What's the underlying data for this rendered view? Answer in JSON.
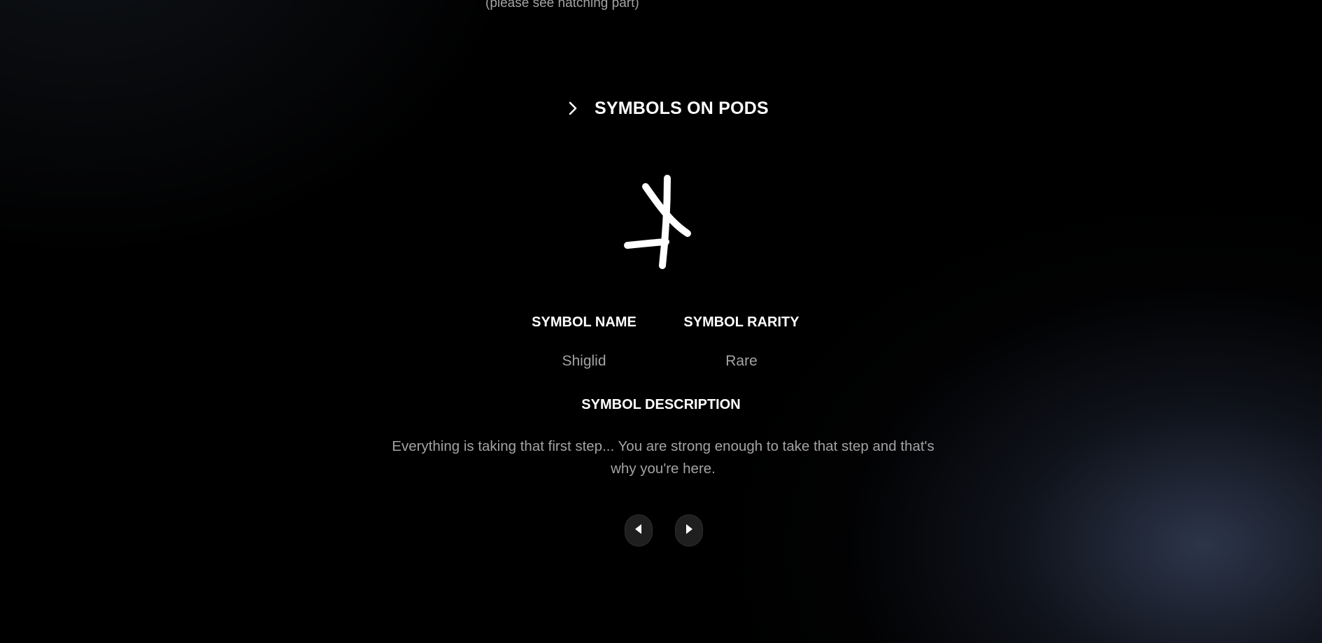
{
  "top_note": "(please see hatching part)",
  "section": {
    "title": "SYMBOLS ON PODS",
    "toggle_icon": "chevron-right-icon"
  },
  "symbol": {
    "glyph_icon": "shiglid-symbol-icon",
    "name_label": "SYMBOL NAME",
    "name_value": "Shiglid",
    "rarity_label": "SYMBOL RARITY",
    "rarity_value": "Rare",
    "description_label": "SYMBOL DESCRIPTION",
    "description": "Everything is taking that first step... You are strong enough to take that step and that's why you're here."
  },
  "navigation": {
    "prev_icon": "triangle-left-icon",
    "next_icon": "triangle-right-icon"
  },
  "colors": {
    "background": "#000000",
    "text_primary": "#ffffff",
    "text_secondary": "#a3a3a3",
    "button_bg": "#1f1f1f",
    "glow": "#343e56"
  }
}
